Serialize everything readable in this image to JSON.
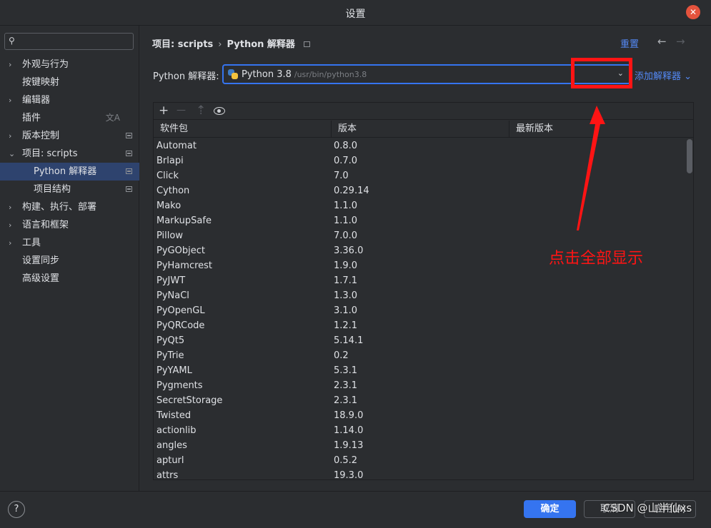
{
  "window": {
    "title": "设置"
  },
  "sidebar": {
    "search_placeholder": "",
    "items": [
      {
        "label": "外观与行为",
        "expandable": true,
        "chev": "›"
      },
      {
        "label": "按键映射",
        "expandable": false,
        "chev": ""
      },
      {
        "label": "编辑器",
        "expandable": true,
        "chev": "›"
      },
      {
        "label": "插件",
        "expandable": false,
        "chev": ""
      },
      {
        "label": "版本控制",
        "expandable": true,
        "chev": "›"
      },
      {
        "label": "项目: scripts",
        "expandable": true,
        "chev": "⌄"
      },
      {
        "label": "Python 解释器",
        "expandable": false,
        "chev": ""
      },
      {
        "label": "项目结构",
        "expandable": false,
        "chev": ""
      },
      {
        "label": "构建、执行、部署",
        "expandable": true,
        "chev": "›"
      },
      {
        "label": "语言和框架",
        "expandable": true,
        "chev": "›"
      },
      {
        "label": "工具",
        "expandable": true,
        "chev": "›"
      },
      {
        "label": "设置同步",
        "expandable": false,
        "chev": ""
      },
      {
        "label": "高级设置",
        "expandable": false,
        "chev": ""
      }
    ],
    "selected_index": 6
  },
  "header": {
    "breadcrumb_parent": "项目: scripts",
    "breadcrumb_sep": "›",
    "breadcrumb_current": "Python 解释器",
    "reset_label": "重置",
    "back_arrow": "←",
    "forward_arrow": "→"
  },
  "interpreter": {
    "label": "Python 解释器:",
    "name": "Python 3.8",
    "path": "/usr/bin/python3.8",
    "chevron": "⌄",
    "add_label": "添加解释器 ⌄"
  },
  "toolbar": {
    "add": "+",
    "remove": "—",
    "upgrade": "⇡"
  },
  "table": {
    "columns": [
      "软件包",
      "版本",
      "最新版本"
    ],
    "rows": [
      {
        "name": "Automat",
        "version": "0.8.0",
        "latest": ""
      },
      {
        "name": "Brlapi",
        "version": "0.7.0",
        "latest": ""
      },
      {
        "name": "Click",
        "version": "7.0",
        "latest": ""
      },
      {
        "name": "Cython",
        "version": "0.29.14",
        "latest": ""
      },
      {
        "name": "Mako",
        "version": "1.1.0",
        "latest": ""
      },
      {
        "name": "MarkupSafe",
        "version": "1.1.0",
        "latest": ""
      },
      {
        "name": "Pillow",
        "version": "7.0.0",
        "latest": ""
      },
      {
        "name": "PyGObject",
        "version": "3.36.0",
        "latest": ""
      },
      {
        "name": "PyHamcrest",
        "version": "1.9.0",
        "latest": ""
      },
      {
        "name": "PyJWT",
        "version": "1.7.1",
        "latest": ""
      },
      {
        "name": "PyNaCl",
        "version": "1.3.0",
        "latest": ""
      },
      {
        "name": "PyOpenGL",
        "version": "3.1.0",
        "latest": ""
      },
      {
        "name": "PyQRCode",
        "version": "1.2.1",
        "latest": ""
      },
      {
        "name": "PyQt5",
        "version": "5.14.1",
        "latest": ""
      },
      {
        "name": "PyTrie",
        "version": "0.2",
        "latest": ""
      },
      {
        "name": "PyYAML",
        "version": "5.3.1",
        "latest": ""
      },
      {
        "name": "Pygments",
        "version": "2.3.1",
        "latest": ""
      },
      {
        "name": "SecretStorage",
        "version": "2.3.1",
        "latest": ""
      },
      {
        "name": "Twisted",
        "version": "18.9.0",
        "latest": ""
      },
      {
        "name": "actionlib",
        "version": "1.14.0",
        "latest": ""
      },
      {
        "name": "angles",
        "version": "1.9.13",
        "latest": ""
      },
      {
        "name": "apturl",
        "version": "0.5.2",
        "latest": ""
      },
      {
        "name": "attrs",
        "version": "19.3.0",
        "latest": ""
      }
    ]
  },
  "annotation": {
    "text": "点击全部显示",
    "color": "#ff1414"
  },
  "footer": {
    "help": "?",
    "ok_label": "确定",
    "cancel_label": "取消",
    "apply_label": "应用(A)",
    "watermark": "CSDN @山半仙xs"
  },
  "colors": {
    "accent": "#3574f0",
    "link": "#548af7",
    "background": "#2b2d30",
    "selection": "#2e436e"
  }
}
